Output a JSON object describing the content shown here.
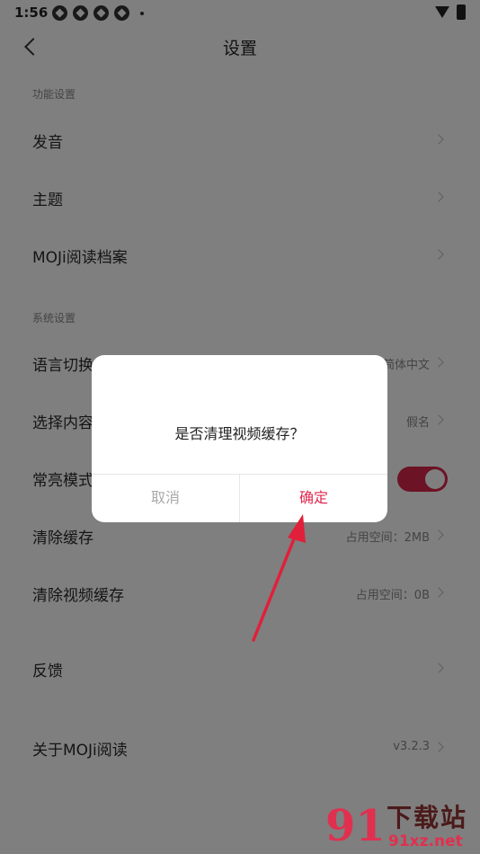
{
  "status_bar": {
    "time": "1:56"
  },
  "header": {
    "title": "设置"
  },
  "sections": [
    {
      "label": "功能设置",
      "items": [
        {
          "label": "发音",
          "value": ""
        },
        {
          "label": "主题",
          "value": ""
        },
        {
          "label": "MOJi阅读档案",
          "value": ""
        }
      ]
    },
    {
      "label": "系统设置",
      "items": [
        {
          "label": "语言切换",
          "value": "简体中文"
        },
        {
          "label": "选择内容",
          "value": "假名"
        },
        {
          "label": "常亮模式",
          "value": "",
          "toggle_on": true
        },
        {
          "label": "清除缓存",
          "value": "占用空间：2MB"
        },
        {
          "label": "清除视频缓存",
          "value": "占用空间：0B"
        }
      ]
    }
  ],
  "feedback": {
    "label": "反馈"
  },
  "about": {
    "label": "关于MOJi阅读",
    "value": "v3.2.3"
  },
  "dialog": {
    "message": "是否清理视频缓存？",
    "cancel_label": "取消",
    "confirm_label": "确定"
  },
  "watermark": {
    "logo_text": "91",
    "title": "下载站",
    "url": "91xz.net"
  },
  "colors": {
    "accent": "#e0284f",
    "annotation_arrow": "#e0203a"
  }
}
